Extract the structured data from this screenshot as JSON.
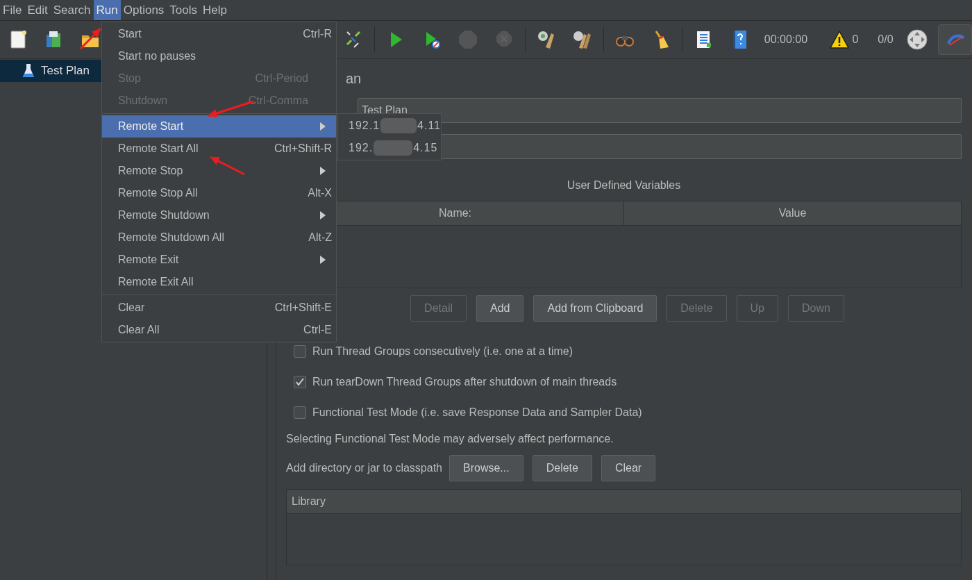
{
  "menu_bar": [
    {
      "label": "File",
      "selected": false
    },
    {
      "label": "Edit",
      "selected": false
    },
    {
      "label": "Search",
      "selected": false
    },
    {
      "label": "Run",
      "selected": true
    },
    {
      "label": "Options",
      "selected": false
    },
    {
      "label": "Tools",
      "selected": false
    },
    {
      "label": "Help",
      "selected": false
    }
  ],
  "toolbar": {
    "left_icons": [
      {
        "kind": "new",
        "disabled": false
      },
      {
        "kind": "templates",
        "disabled": false
      },
      {
        "kind": "open",
        "disabled": false
      }
    ],
    "right_icons": [
      {
        "kind": "remote",
        "disabled": false
      },
      {
        "kind": "separator"
      },
      {
        "kind": "start",
        "disabled": false
      },
      {
        "kind": "start_no_pause",
        "disabled": false
      },
      {
        "kind": "stop",
        "disabled": true
      },
      {
        "kind": "shutdown",
        "disabled": true
      },
      {
        "kind": "separator"
      },
      {
        "kind": "clear",
        "disabled": false
      },
      {
        "kind": "clear_all",
        "disabled": false
      },
      {
        "kind": "separator"
      },
      {
        "kind": "search",
        "disabled": false
      },
      {
        "kind": "reset",
        "disabled": false
      },
      {
        "kind": "separator"
      },
      {
        "kind": "functions",
        "disabled": false
      },
      {
        "kind": "help",
        "disabled": false
      }
    ],
    "timer": "00:00:00",
    "warning_count": "0",
    "threads": "0/0"
  },
  "tree": {
    "items": [
      {
        "label": "Test Plan",
        "selected": true
      }
    ]
  },
  "run_menu": {
    "items": [
      {
        "kind": "item",
        "label": "Start",
        "shortcut": "Ctrl-R",
        "disabled": false,
        "submenu": false,
        "selected": false
      },
      {
        "kind": "item",
        "label": "Start no pauses",
        "disabled": false,
        "submenu": false,
        "selected": false
      },
      {
        "kind": "item",
        "label": "Stop",
        "shortcut": "Ctrl-Period",
        "disabled": true,
        "submenu": false,
        "selected": false
      },
      {
        "kind": "item",
        "label": "Shutdown",
        "shortcut": "Ctrl-Comma",
        "disabled": true,
        "submenu": false,
        "selected": false
      },
      {
        "kind": "separator"
      },
      {
        "kind": "item",
        "label": "Remote Start",
        "disabled": false,
        "submenu": true,
        "selected": true
      },
      {
        "kind": "item",
        "label": "Remote Start All",
        "shortcut": "Ctrl+Shift-R",
        "disabled": false,
        "submenu": false,
        "selected": false
      },
      {
        "kind": "item",
        "label": "Remote Stop",
        "disabled": false,
        "submenu": true,
        "selected": false
      },
      {
        "kind": "item",
        "label": "Remote Stop All",
        "shortcut": "Alt-X",
        "disabled": false,
        "submenu": false,
        "selected": false
      },
      {
        "kind": "item",
        "label": "Remote Shutdown",
        "disabled": false,
        "submenu": true,
        "selected": false
      },
      {
        "kind": "item",
        "label": "Remote Shutdown All",
        "shortcut": "Alt-Z",
        "disabled": false,
        "submenu": false,
        "selected": false
      },
      {
        "kind": "item",
        "label": "Remote Exit",
        "disabled": false,
        "submenu": true,
        "selected": false
      },
      {
        "kind": "item",
        "label": "Remote Exit All",
        "disabled": false,
        "submenu": false,
        "selected": false
      },
      {
        "kind": "separator"
      },
      {
        "kind": "item",
        "label": "Clear",
        "shortcut": "Ctrl+Shift-E",
        "disabled": false,
        "submenu": false,
        "selected": false
      },
      {
        "kind": "item",
        "label": "Clear All",
        "shortcut": "Ctrl-E",
        "disabled": false,
        "submenu": false,
        "selected": false
      }
    ]
  },
  "remote_start_submenu": {
    "items": [
      {
        "prefix": "192.1",
        "suffix": "4.11"
      },
      {
        "prefix": "192.",
        "suffix": "4.15"
      }
    ]
  },
  "panel": {
    "title": "an",
    "name_field": {
      "value": "Test Plan"
    },
    "variables_table": {
      "title": "User Defined Variables",
      "columns": [
        "Name:",
        "Value"
      ]
    },
    "buttons": [
      {
        "label": "Detail",
        "disabled": true
      },
      {
        "label": "Add",
        "disabled": false
      },
      {
        "label": "Add from Clipboard",
        "disabled": false
      },
      {
        "label": "Delete",
        "disabled": true
      },
      {
        "label": "Up",
        "disabled": true
      },
      {
        "label": "Down",
        "disabled": true
      }
    ],
    "checkboxes": [
      {
        "label": "Run Thread Groups consecutively (i.e. one at a time)",
        "checked": false
      },
      {
        "label": "Run tearDown Thread Groups after shutdown of main threads",
        "checked": true
      },
      {
        "label": "Functional Test Mode (i.e. save Response Data and Sampler Data)",
        "checked": false
      }
    ],
    "note": "Selecting Functional Test Mode may adversely affect performance.",
    "classpath": {
      "label": "Add directory or jar to classpath",
      "buttons": [
        "Browse...",
        "Delete",
        "Clear"
      ]
    },
    "library_table": {
      "columns": [
        "Library"
      ]
    }
  }
}
